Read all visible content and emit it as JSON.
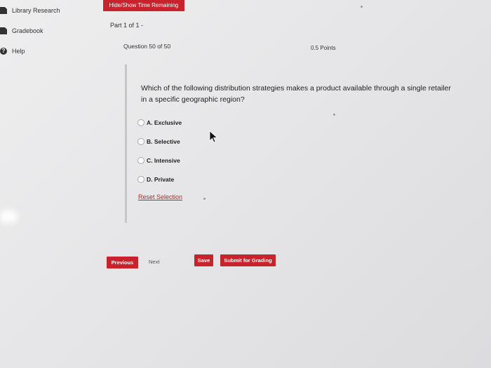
{
  "sidebar": {
    "items": [
      {
        "label": "Library Research",
        "icon": "document-icon"
      },
      {
        "label": "Gradebook",
        "icon": "document-icon"
      },
      {
        "label": "Help",
        "icon": "help-icon"
      }
    ]
  },
  "header": {
    "time_button": "Hide/Show Time Remaining",
    "part": "Part 1 of 1 -",
    "question_number": "Question 50 of 50",
    "points": "0.5 Points"
  },
  "question": {
    "text": "Which of the following distribution strategies makes a product available through a single retailer in a specific geographic region?",
    "choices": [
      "A. Exclusive",
      "B. Selective",
      "C. Intensive",
      "D. Private"
    ],
    "reset_label": "Reset Selection"
  },
  "footer": {
    "previous": "Previous",
    "next": "Next",
    "save": "Save",
    "submit": "Submit for Grading"
  },
  "colors": {
    "accent": "#c8232c",
    "link": "#b02a2a"
  }
}
